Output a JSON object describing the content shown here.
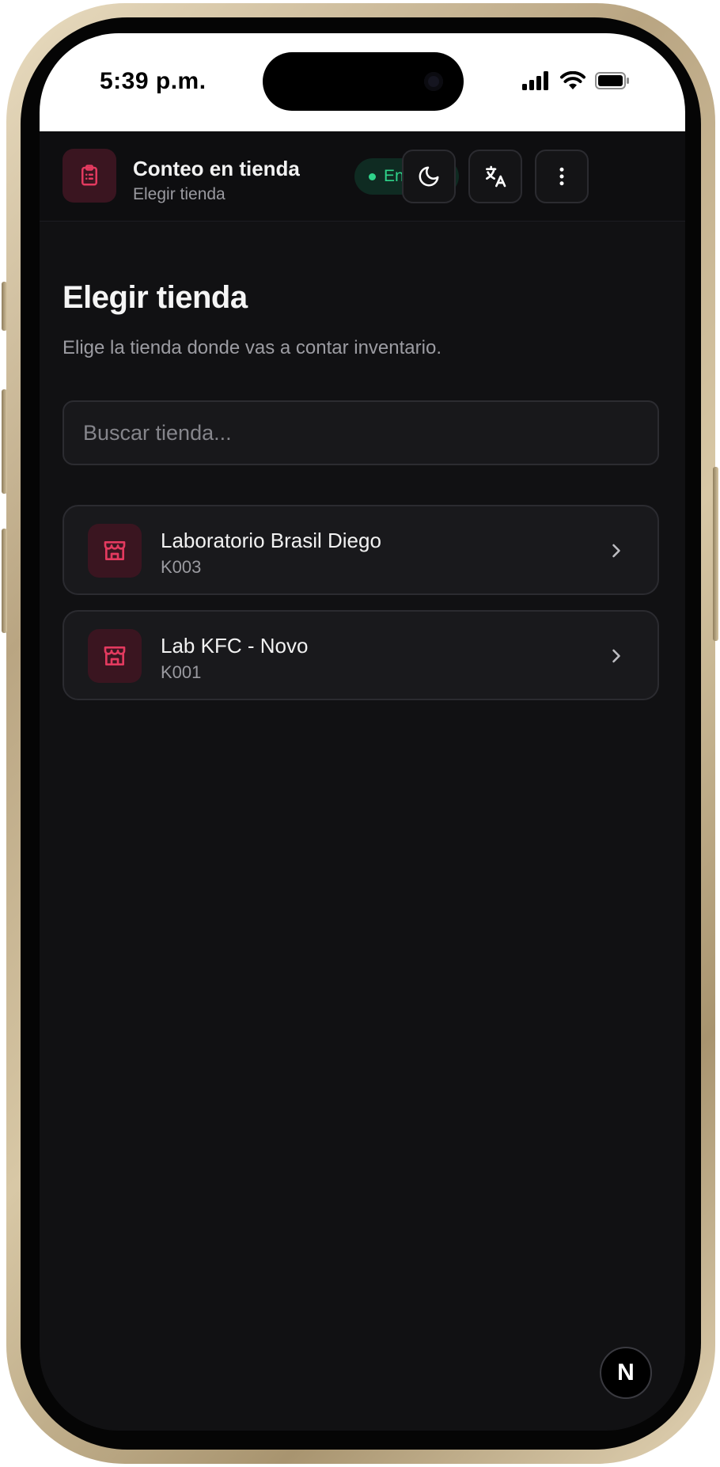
{
  "status_bar": {
    "time": "5:39 p.m.",
    "icons": [
      "cellular-signal-icon",
      "wifi-icon",
      "battery-icon"
    ]
  },
  "header": {
    "app_icon": "clipboard-icon",
    "title": "Conteo en tienda",
    "subtitle": "Elegir tienda",
    "status": "En línea",
    "status_color": "#2fd38a",
    "buttons": [
      "theme-toggle-moon-icon",
      "language-translate-icon",
      "more-vertical-icon"
    ]
  },
  "page": {
    "title": "Elegir tienda",
    "description": "Elige la tienda donde vas a contar inventario."
  },
  "search": {
    "placeholder": "Buscar tienda...",
    "value": ""
  },
  "stores": [
    {
      "name": "Laboratorio Brasil Diego",
      "code": "K003",
      "icon": "store-icon"
    },
    {
      "name": "Lab KFC - Novo",
      "code": "K001",
      "icon": "store-icon"
    }
  ],
  "accent_color": "#e33a5f",
  "badge": {
    "label": "N"
  }
}
